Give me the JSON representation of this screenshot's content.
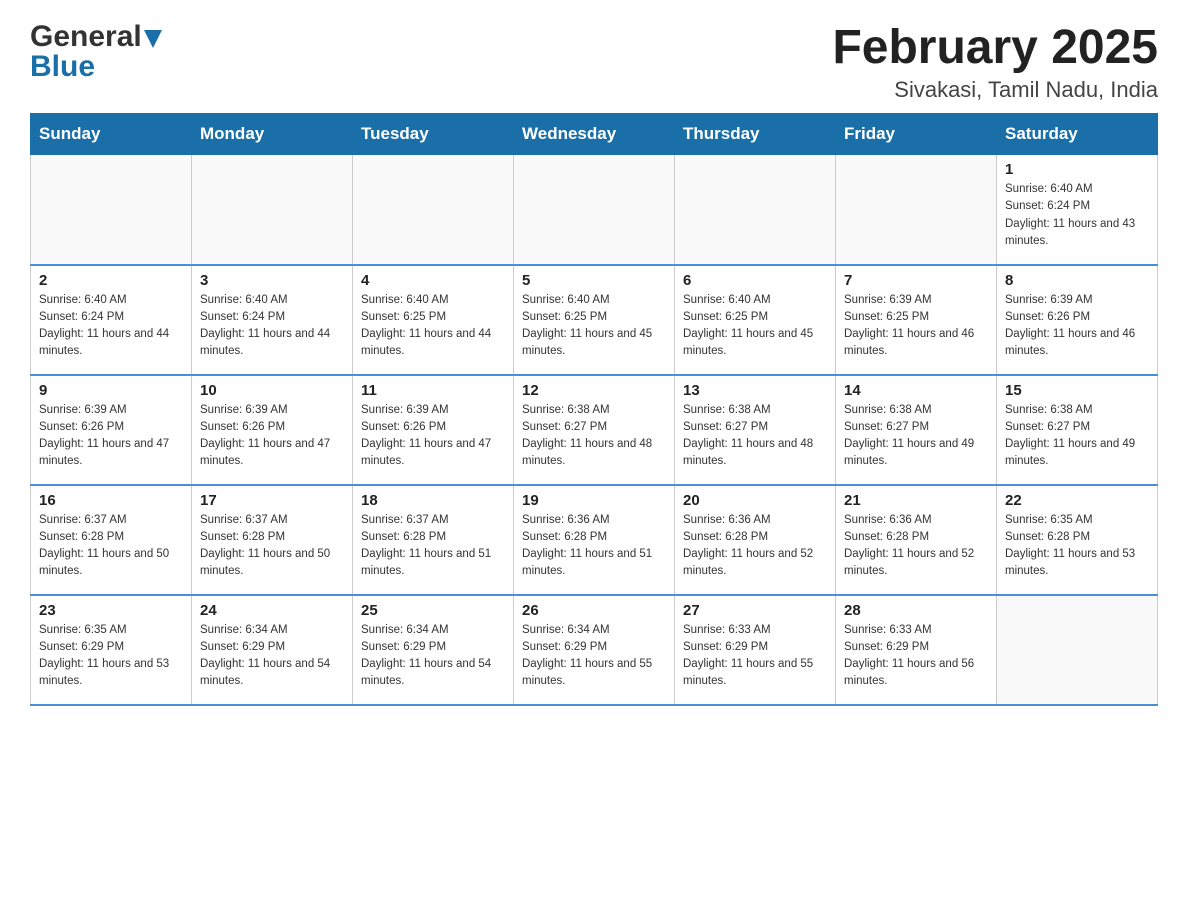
{
  "header": {
    "logo_general": "General",
    "logo_blue": "Blue",
    "month_title": "February 2025",
    "location": "Sivakasi, Tamil Nadu, India"
  },
  "days_of_week": [
    "Sunday",
    "Monday",
    "Tuesday",
    "Wednesday",
    "Thursday",
    "Friday",
    "Saturday"
  ],
  "weeks": [
    [
      {
        "day": "",
        "sunrise": "",
        "sunset": "",
        "daylight": ""
      },
      {
        "day": "",
        "sunrise": "",
        "sunset": "",
        "daylight": ""
      },
      {
        "day": "",
        "sunrise": "",
        "sunset": "",
        "daylight": ""
      },
      {
        "day": "",
        "sunrise": "",
        "sunset": "",
        "daylight": ""
      },
      {
        "day": "",
        "sunrise": "",
        "sunset": "",
        "daylight": ""
      },
      {
        "day": "",
        "sunrise": "",
        "sunset": "",
        "daylight": ""
      },
      {
        "day": "1",
        "sunrise": "Sunrise: 6:40 AM",
        "sunset": "Sunset: 6:24 PM",
        "daylight": "Daylight: 11 hours and 43 minutes."
      }
    ],
    [
      {
        "day": "2",
        "sunrise": "Sunrise: 6:40 AM",
        "sunset": "Sunset: 6:24 PM",
        "daylight": "Daylight: 11 hours and 44 minutes."
      },
      {
        "day": "3",
        "sunrise": "Sunrise: 6:40 AM",
        "sunset": "Sunset: 6:24 PM",
        "daylight": "Daylight: 11 hours and 44 minutes."
      },
      {
        "day": "4",
        "sunrise": "Sunrise: 6:40 AM",
        "sunset": "Sunset: 6:25 PM",
        "daylight": "Daylight: 11 hours and 44 minutes."
      },
      {
        "day": "5",
        "sunrise": "Sunrise: 6:40 AM",
        "sunset": "Sunset: 6:25 PM",
        "daylight": "Daylight: 11 hours and 45 minutes."
      },
      {
        "day": "6",
        "sunrise": "Sunrise: 6:40 AM",
        "sunset": "Sunset: 6:25 PM",
        "daylight": "Daylight: 11 hours and 45 minutes."
      },
      {
        "day": "7",
        "sunrise": "Sunrise: 6:39 AM",
        "sunset": "Sunset: 6:25 PM",
        "daylight": "Daylight: 11 hours and 46 minutes."
      },
      {
        "day": "8",
        "sunrise": "Sunrise: 6:39 AM",
        "sunset": "Sunset: 6:26 PM",
        "daylight": "Daylight: 11 hours and 46 minutes."
      }
    ],
    [
      {
        "day": "9",
        "sunrise": "Sunrise: 6:39 AM",
        "sunset": "Sunset: 6:26 PM",
        "daylight": "Daylight: 11 hours and 47 minutes."
      },
      {
        "day": "10",
        "sunrise": "Sunrise: 6:39 AM",
        "sunset": "Sunset: 6:26 PM",
        "daylight": "Daylight: 11 hours and 47 minutes."
      },
      {
        "day": "11",
        "sunrise": "Sunrise: 6:39 AM",
        "sunset": "Sunset: 6:26 PM",
        "daylight": "Daylight: 11 hours and 47 minutes."
      },
      {
        "day": "12",
        "sunrise": "Sunrise: 6:38 AM",
        "sunset": "Sunset: 6:27 PM",
        "daylight": "Daylight: 11 hours and 48 minutes."
      },
      {
        "day": "13",
        "sunrise": "Sunrise: 6:38 AM",
        "sunset": "Sunset: 6:27 PM",
        "daylight": "Daylight: 11 hours and 48 minutes."
      },
      {
        "day": "14",
        "sunrise": "Sunrise: 6:38 AM",
        "sunset": "Sunset: 6:27 PM",
        "daylight": "Daylight: 11 hours and 49 minutes."
      },
      {
        "day": "15",
        "sunrise": "Sunrise: 6:38 AM",
        "sunset": "Sunset: 6:27 PM",
        "daylight": "Daylight: 11 hours and 49 minutes."
      }
    ],
    [
      {
        "day": "16",
        "sunrise": "Sunrise: 6:37 AM",
        "sunset": "Sunset: 6:28 PM",
        "daylight": "Daylight: 11 hours and 50 minutes."
      },
      {
        "day": "17",
        "sunrise": "Sunrise: 6:37 AM",
        "sunset": "Sunset: 6:28 PM",
        "daylight": "Daylight: 11 hours and 50 minutes."
      },
      {
        "day": "18",
        "sunrise": "Sunrise: 6:37 AM",
        "sunset": "Sunset: 6:28 PM",
        "daylight": "Daylight: 11 hours and 51 minutes."
      },
      {
        "day": "19",
        "sunrise": "Sunrise: 6:36 AM",
        "sunset": "Sunset: 6:28 PM",
        "daylight": "Daylight: 11 hours and 51 minutes."
      },
      {
        "day": "20",
        "sunrise": "Sunrise: 6:36 AM",
        "sunset": "Sunset: 6:28 PM",
        "daylight": "Daylight: 11 hours and 52 minutes."
      },
      {
        "day": "21",
        "sunrise": "Sunrise: 6:36 AM",
        "sunset": "Sunset: 6:28 PM",
        "daylight": "Daylight: 11 hours and 52 minutes."
      },
      {
        "day": "22",
        "sunrise": "Sunrise: 6:35 AM",
        "sunset": "Sunset: 6:28 PM",
        "daylight": "Daylight: 11 hours and 53 minutes."
      }
    ],
    [
      {
        "day": "23",
        "sunrise": "Sunrise: 6:35 AM",
        "sunset": "Sunset: 6:29 PM",
        "daylight": "Daylight: 11 hours and 53 minutes."
      },
      {
        "day": "24",
        "sunrise": "Sunrise: 6:34 AM",
        "sunset": "Sunset: 6:29 PM",
        "daylight": "Daylight: 11 hours and 54 minutes."
      },
      {
        "day": "25",
        "sunrise": "Sunrise: 6:34 AM",
        "sunset": "Sunset: 6:29 PM",
        "daylight": "Daylight: 11 hours and 54 minutes."
      },
      {
        "day": "26",
        "sunrise": "Sunrise: 6:34 AM",
        "sunset": "Sunset: 6:29 PM",
        "daylight": "Daylight: 11 hours and 55 minutes."
      },
      {
        "day": "27",
        "sunrise": "Sunrise: 6:33 AM",
        "sunset": "Sunset: 6:29 PM",
        "daylight": "Daylight: 11 hours and 55 minutes."
      },
      {
        "day": "28",
        "sunrise": "Sunrise: 6:33 AM",
        "sunset": "Sunset: 6:29 PM",
        "daylight": "Daylight: 11 hours and 56 minutes."
      },
      {
        "day": "",
        "sunrise": "",
        "sunset": "",
        "daylight": ""
      }
    ]
  ]
}
